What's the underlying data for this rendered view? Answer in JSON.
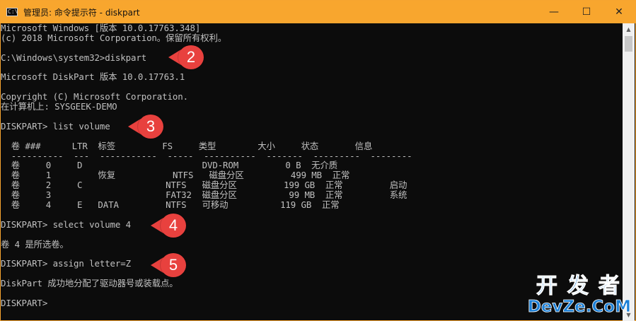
{
  "window": {
    "title": "管理员: 命令提示符 - diskpart",
    "icon_label": "C:\\",
    "buttons": {
      "minimize": "—",
      "maximize": "☐",
      "close": "✕"
    }
  },
  "console_lines": [
    "Microsoft Windows [版本 10.0.17763.348]",
    "(c) 2018 Microsoft Corporation。保留所有权利。",
    "",
    "C:\\Windows\\system32>diskpart",
    "",
    "Microsoft DiskPart 版本 10.0.17763.1",
    "",
    "Copyright (C) Microsoft Corporation.",
    "在计算机上: SYSGEEK-DEMO",
    "",
    "DISKPART> list volume",
    "",
    "  卷 ###      LTR  标签         FS     类型        大小     状态       信息",
    "  ----------  ---  -----------  -----  ----------  -------  ---------  --------",
    "  卷     0     D                       DVD-ROM         0 B  无介质",
    "  卷     1         恢复           NTFS   磁盘分区         499 MB  正常",
    "  卷     2     C                NTFS   磁盘分区         199 GB  正常         启动",
    "  卷     3                      FAT32  磁盘分区          99 MB  正常         系统",
    "  卷     4     E   DATA         NTFS   可移动          119 GB  正常",
    "",
    "DISKPART> select volume 4",
    "",
    "卷 4 是所选卷。",
    "",
    "DISKPART> assign letter=Z",
    "",
    "DiskPart 成功地分配了驱动器号或装载点。",
    "",
    "DISKPART>"
  ],
  "step_badges": [
    "2",
    "3",
    "4",
    "5"
  ],
  "scrollbar": {
    "up_arrow": "▲",
    "down_arrow": "▼"
  },
  "watermark": {
    "top": "开发者",
    "bottom": "DevZe.CoM"
  }
}
